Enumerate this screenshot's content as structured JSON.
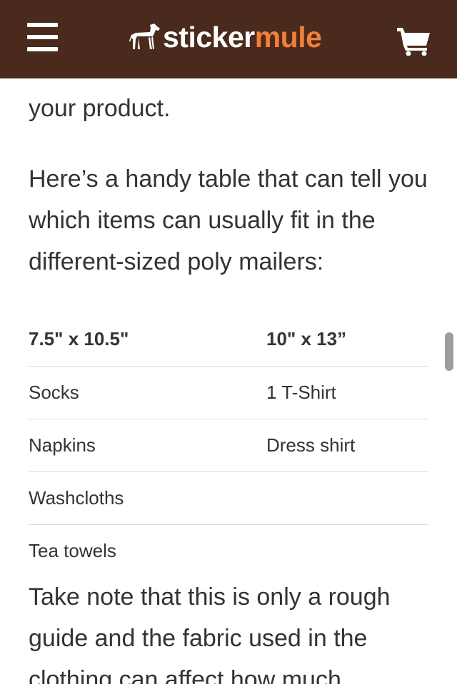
{
  "header": {
    "logo_word1": "sticker",
    "logo_word2": "mule",
    "menu_icon": "hamburger-icon",
    "cart_icon": "cart-icon",
    "bg_color": "#4a2a1c",
    "accent_color": "#f07f3a"
  },
  "article": {
    "prev_paragraph_end": "your product.",
    "intro_paragraph": "Here’s a handy table that can tell you which items can usually fit in the different-sized poly mailers:",
    "table": {
      "headers": [
        "7.5\" x 10.5\"",
        "10\" x 13”"
      ],
      "rows": [
        [
          "Socks",
          "1 T-Shirt"
        ],
        [
          "Napkins",
          "Dress shirt"
        ],
        [
          "Washcloths",
          ""
        ],
        [
          "Tea towels",
          ""
        ]
      ]
    },
    "note_paragraph": "Take note that this is only a rough guide and the fabric used in the clothing can affect how much"
  }
}
